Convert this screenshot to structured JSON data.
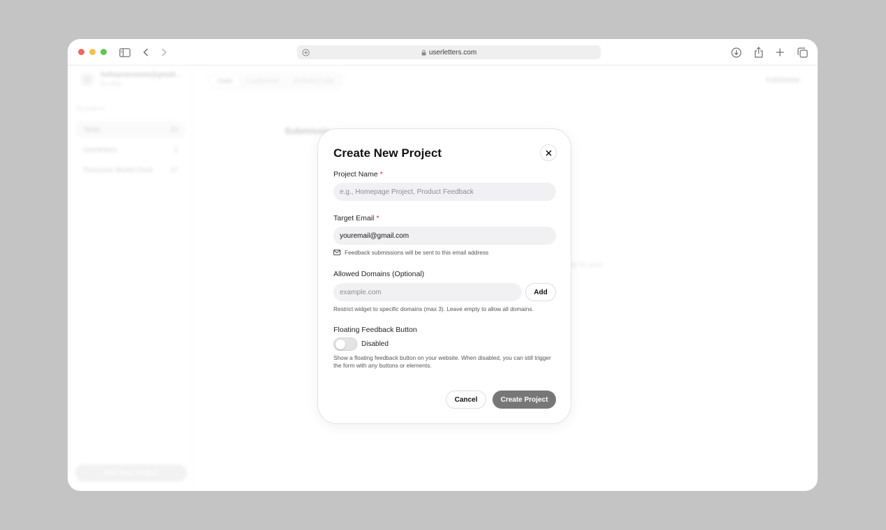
{
  "browser": {
    "url": "userletters.com"
  },
  "sidebar": {
    "avatar_initial": "H",
    "account_email": "hellopracnsum@gmail...",
    "account_plan": "Pro Plan",
    "section_label": "My projects",
    "projects": [
      {
        "name": "Tactic",
        "count": "22"
      },
      {
        "name": "Userletters",
        "count": "1"
      },
      {
        "name": "Timezone World Clock",
        "count": "17"
      }
    ],
    "add_project_label": "Add New Project"
  },
  "main": {
    "tabs": [
      "Data",
      "Customize",
      "Embed Code"
    ],
    "edit_delete": "Edit/Delete",
    "submissions_title": "Submissio",
    "side_text": "de to your"
  },
  "modal": {
    "title": "Create New Project",
    "project_name_label": "Project Name",
    "required_marker": "*",
    "project_name_placeholder": "e.g., Homepage Project, Product Feedback",
    "target_email_label": "Target Email",
    "target_email_value": "youremail@gmail.com",
    "email_hint": "Feedback submissions will be sent to this email address",
    "allowed_domains_label": "Allowed Domains (Optional)",
    "domain_placeholder": "example.com",
    "add_label": "Add",
    "domains_hint": "Restrict widget to specific domains (max 3). Leave empty to allow all domains.",
    "floating_label": "Floating Feedback Button",
    "toggle_state": "Disabled",
    "floating_desc": "Show a floating feedback button on your website. When disabled, you can still trigger the form with any buttons or elements.",
    "cancel_label": "Cancel",
    "create_label": "Create Project"
  }
}
